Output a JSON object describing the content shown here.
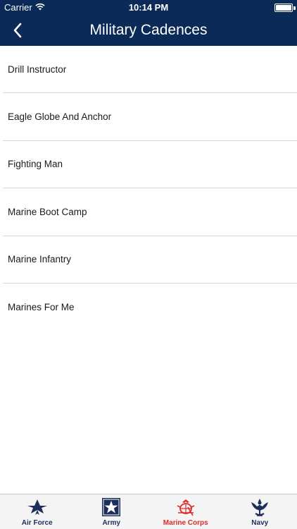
{
  "status_bar": {
    "carrier": "Carrier",
    "time": "10:14 PM"
  },
  "nav": {
    "title": "Military Cadences",
    "back_icon": "chevron-left-icon"
  },
  "cadences": [
    {
      "label": "Drill Instructor"
    },
    {
      "label": "Eagle Globe And Anchor"
    },
    {
      "label": "Fighting Man"
    },
    {
      "label": "Marine Boot Camp"
    },
    {
      "label": "Marine Infantry"
    },
    {
      "label": "Marines For Me"
    }
  ],
  "tabs": [
    {
      "label": "Air Force",
      "icon": "air-force-icon",
      "active": false
    },
    {
      "label": "Army",
      "icon": "army-star-icon",
      "active": false
    },
    {
      "label": "Marine Corps",
      "icon": "marine-corps-emblem-icon",
      "active": true
    },
    {
      "label": "Navy",
      "icon": "navy-eagle-icon",
      "active": false
    }
  ],
  "colors": {
    "header_bg": "#0b2a57",
    "tab_label": "#1c2f5a",
    "tab_active": "#d92c2c",
    "separator": "#d6d6d6"
  }
}
